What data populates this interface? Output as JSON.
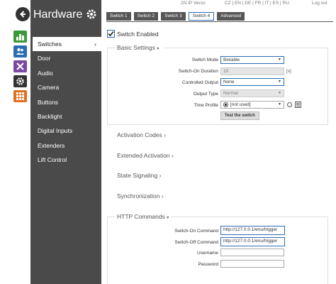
{
  "header": {
    "model": "2N IP Verso",
    "languages": "CZ | EN | DE | FR | IT | ES | RU",
    "logout": "Log out",
    "tabs": [
      {
        "label": "Switch 1",
        "selected": false
      },
      {
        "label": "Switch 2",
        "selected": false
      },
      {
        "label": "Switch 3",
        "selected": false
      },
      {
        "label": "Switch 4",
        "selected": true
      },
      {
        "label": "Advanced",
        "selected": false
      }
    ]
  },
  "sidebar": {
    "title": "Hardware",
    "items": [
      {
        "label": "Switches",
        "active": true,
        "chevron": "›"
      },
      {
        "label": "Door"
      },
      {
        "label": "Audio"
      },
      {
        "label": "Camera"
      },
      {
        "label": "Buttons"
      },
      {
        "label": "Backlight"
      },
      {
        "label": "Digital Inputs"
      },
      {
        "label": "Extenders"
      },
      {
        "label": "Lift Control"
      }
    ],
    "section_icons": [
      "status-icon",
      "directory-icon",
      "services-icon",
      "hardware-icon",
      "system-icon"
    ],
    "colors": {
      "status": "#3a9a3a",
      "directory": "#2a6db5",
      "services": "#7a4aa0",
      "hardware": "#333333",
      "system": "#e07020",
      "sidebar_bg": "#4a4a4a",
      "accent": "#2a6db5"
    }
  },
  "switch": {
    "enabled_label": "Switch Enabled",
    "enabled": true
  },
  "basic": {
    "title": "Basic Settings",
    "chevron": "▾",
    "fields": {
      "mode_label": "Switch Mode",
      "mode_value": "Bistable",
      "duration_label": "Switch-On Duration",
      "duration_value": "10",
      "duration_unit": "[s]",
      "output_label": "Controlled Output",
      "output_value": "None",
      "output_type_label": "Output Type",
      "output_type_value": "Normal",
      "time_profile_label": "Time Profile",
      "time_profile_value": "[not used]"
    },
    "test_button": "Test the switch"
  },
  "collapsed_sections": [
    {
      "label": "Activation Codes",
      "chevron": "›"
    },
    {
      "label": "Extended Activation",
      "chevron": "›"
    },
    {
      "label": "State Signaling",
      "chevron": "›"
    },
    {
      "label": "Synchronization",
      "chevron": "›"
    }
  ],
  "http": {
    "title": "HTTP Commands",
    "chevron": "▾",
    "on_label": "Switch-On Command",
    "on_value": "http://127.0.0.1/enu/trigger",
    "off_label": "Switch-Off Command",
    "off_value": "http://127.0.0.1/enu/trigger",
    "user_label": "Username",
    "user_value": "",
    "pass_label": "Password",
    "pass_value": ""
  }
}
